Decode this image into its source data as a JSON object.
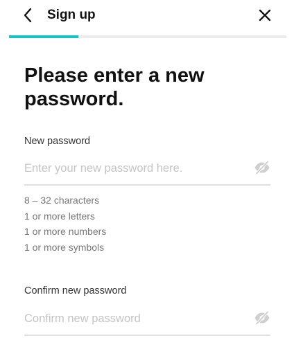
{
  "header": {
    "title": "Sign up",
    "back_icon": "chevron-left-icon",
    "close_icon": "close-icon"
  },
  "progress": {
    "fraction": 0.25,
    "accent_color": "#14c4c6"
  },
  "main": {
    "title": "Please enter a new password.",
    "new_password": {
      "label": "New password",
      "placeholder": "Enter your new password here.",
      "value": "",
      "toggle_icon": "eye-off-icon"
    },
    "rules": [
      "8 – 32 characters",
      "1 or more letters",
      "1 or more numbers",
      "1 or more symbols"
    ],
    "confirm_password": {
      "label": "Confirm new password",
      "placeholder": "Confirm new password",
      "value": "",
      "toggle_icon": "eye-off-icon"
    }
  }
}
